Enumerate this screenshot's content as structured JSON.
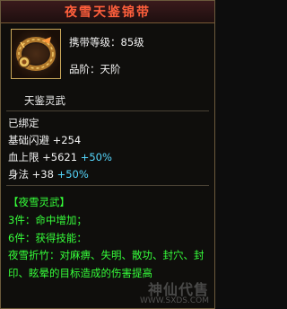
{
  "title": "夜雪天鉴锦带",
  "header": {
    "level_label": "携带等级：85级",
    "grade_label": "品阶：天阶"
  },
  "subtitle": "天鉴灵武",
  "bind_status": "已绑定",
  "stats": [
    {
      "label": "基础闪避",
      "value": "+254",
      "percent": ""
    },
    {
      "label": "血上限",
      "value": "+5621",
      "percent": "+50%"
    },
    {
      "label": "身法",
      "value": "+38",
      "percent": "+50%"
    }
  ],
  "set": {
    "name": "【夜雪灵武】",
    "bonus_3": "3件：命中增加；",
    "bonus_6": "6件：获得技能：",
    "skill_desc": "夜雪折竹：对麻痹、失明、散功、封穴、封印、眩晕的目标造成的伤害提高"
  },
  "watermark": {
    "title": "神仙代售",
    "url": "WWW.SXDS.COM"
  },
  "colors": {
    "title": "#ff5f3c",
    "green": "#36ff3a",
    "cyan": "#56d8ff",
    "border": "#6b5a3c"
  },
  "icon": "belt-icon"
}
